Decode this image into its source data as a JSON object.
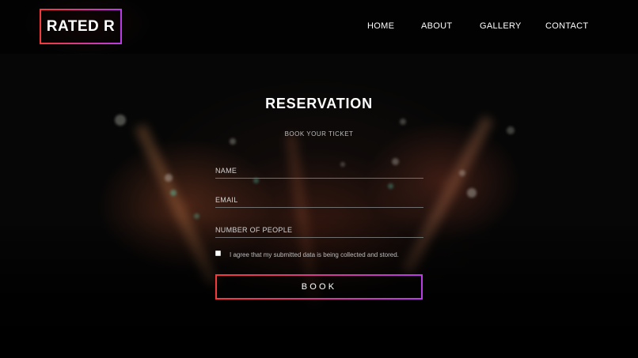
{
  "header": {
    "logo": "RATED R",
    "nav": [
      {
        "label": "HOME"
      },
      {
        "label": "ABOUT"
      },
      {
        "label": "GALLERY"
      },
      {
        "label": "CONTACT"
      }
    ]
  },
  "reservation": {
    "title": "RESERVATION",
    "subtitle": "BOOK YOUR TICKET",
    "name_placeholder": "NAME",
    "email_placeholder": "EMAIL",
    "people_placeholder": "NUMBER OF PEOPLE",
    "consent_label": "I agree that my submitted data is being collected and stored.",
    "consent_checked": false,
    "submit_label": "BOOK"
  },
  "colors": {
    "gradient_start": "#f43a3a",
    "gradient_end": "#b93ce6",
    "background": "#050505"
  }
}
